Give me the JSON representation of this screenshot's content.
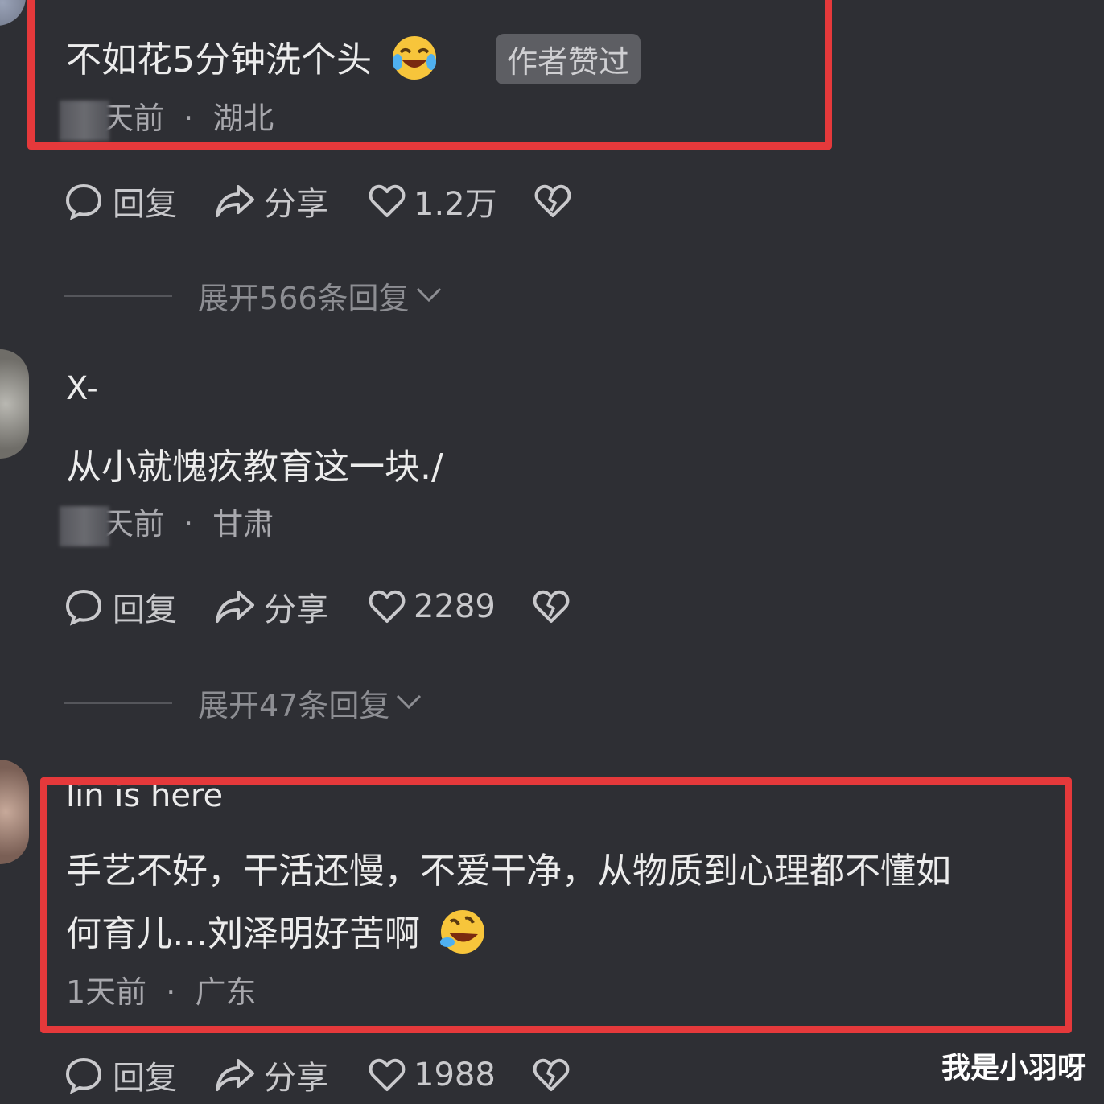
{
  "comments": [
    {
      "text": "不如花5分钟洗个头",
      "badge": "作者赞过",
      "meta_time": "天前",
      "meta_sep": "·",
      "meta_location": "湖北",
      "reply_label": "回复",
      "share_label": "分享",
      "like_count": "1.2万",
      "expand_label": "展开566条回复"
    },
    {
      "username": "X-",
      "text": "从小就愧疚教育这一块./",
      "meta_time": "天前",
      "meta_sep": "·",
      "meta_location": "甘肃",
      "reply_label": "回复",
      "share_label": "分享",
      "like_count": "2289",
      "expand_label": "展开47条回复"
    },
    {
      "username": "lin is here",
      "text_line1": "手艺不好，干活还慢，不爱干净，从物质到心理都不懂如",
      "text_line2": "何育儿…刘泽明好苦啊",
      "meta_time": "1天前",
      "meta_sep": "·",
      "meta_location": "广东",
      "reply_label": "回复",
      "share_label": "分享",
      "like_count": "1988"
    }
  ],
  "watermark": "我是小羽呀",
  "colors": {
    "background": "#2e2f34",
    "highlight_box": "#e5393b",
    "badge_bg": "#5d5e63"
  },
  "icons": [
    "comment-bubble-icon",
    "share-arrow-icon",
    "heart-icon",
    "broken-heart-icon",
    "chevron-down-icon",
    "laughing-crying-emoji",
    "rolling-laughing-emoji"
  ]
}
